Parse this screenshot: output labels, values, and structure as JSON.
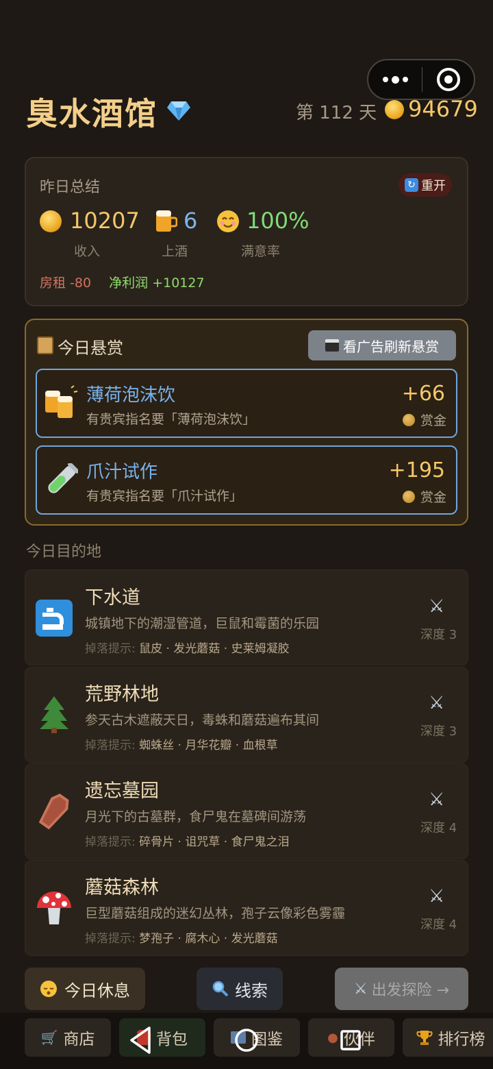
{
  "header": {
    "title": "臭水酒馆",
    "day_text": "第 112 天",
    "gold": "94679"
  },
  "summary": {
    "title": "昨日总结",
    "restart_label": "重开",
    "income": "10207",
    "income_label": "收入",
    "served": "6",
    "served_label": "上酒",
    "satisfaction": "100%",
    "satisfaction_label": "满意率",
    "rent": "房租 -80",
    "net_profit": "净利润 +10127"
  },
  "bounty": {
    "title": "今日悬赏",
    "refresh_label": "看广告刷新悬赏",
    "quests": [
      {
        "name": "薄荷泡沫饮",
        "desc": "有贵宾指名要「薄荷泡沫饮」",
        "reward": "+66",
        "reward_label": "赏金"
      },
      {
        "name": "爪汁试作",
        "desc": "有贵宾指名要「爪汁试作」",
        "reward": "+195",
        "reward_label": "赏金"
      }
    ]
  },
  "destinations": {
    "heading": "今日目的地",
    "drop_prefix": "掉落提示:",
    "items": [
      {
        "name": "下水道",
        "desc": "城镇地下的潮湿管道，巨鼠和霉菌的乐园",
        "drops": "鼠皮 · 发光蘑菇 · 史莱姆凝胶",
        "depth": "深度 3",
        "icon": "faucet-icon"
      },
      {
        "name": "荒野林地",
        "desc": "参天古木遮蔽天日，毒蛛和蘑菇遍布其间",
        "drops": "蜘蛛丝 · 月华花瓣 · 血根草",
        "depth": "深度 3",
        "icon": "pine-tree-icon"
      },
      {
        "name": "遗忘墓园",
        "desc": "月光下的古墓群，食尸鬼在墓碑间游荡",
        "drops": "碎骨片 · 诅咒草 · 食尸鬼之泪",
        "depth": "深度 4",
        "icon": "coffin-icon"
      },
      {
        "name": "蘑菇森林",
        "desc": "巨型蘑菇组成的迷幻丛林，孢子云像彩色雾霾",
        "drops": "梦孢子 · 腐木心 · 发光蘑菇",
        "depth": "深度 4",
        "icon": "mushroom-icon"
      }
    ]
  },
  "actions": {
    "rest": "今日休息",
    "clue": "线索",
    "explore": "出发探险 →"
  },
  "tabs": [
    {
      "label": "商店"
    },
    {
      "label": "背包"
    },
    {
      "label": "图鉴"
    },
    {
      "label": "伙伴"
    },
    {
      "label": "排行榜"
    }
  ]
}
